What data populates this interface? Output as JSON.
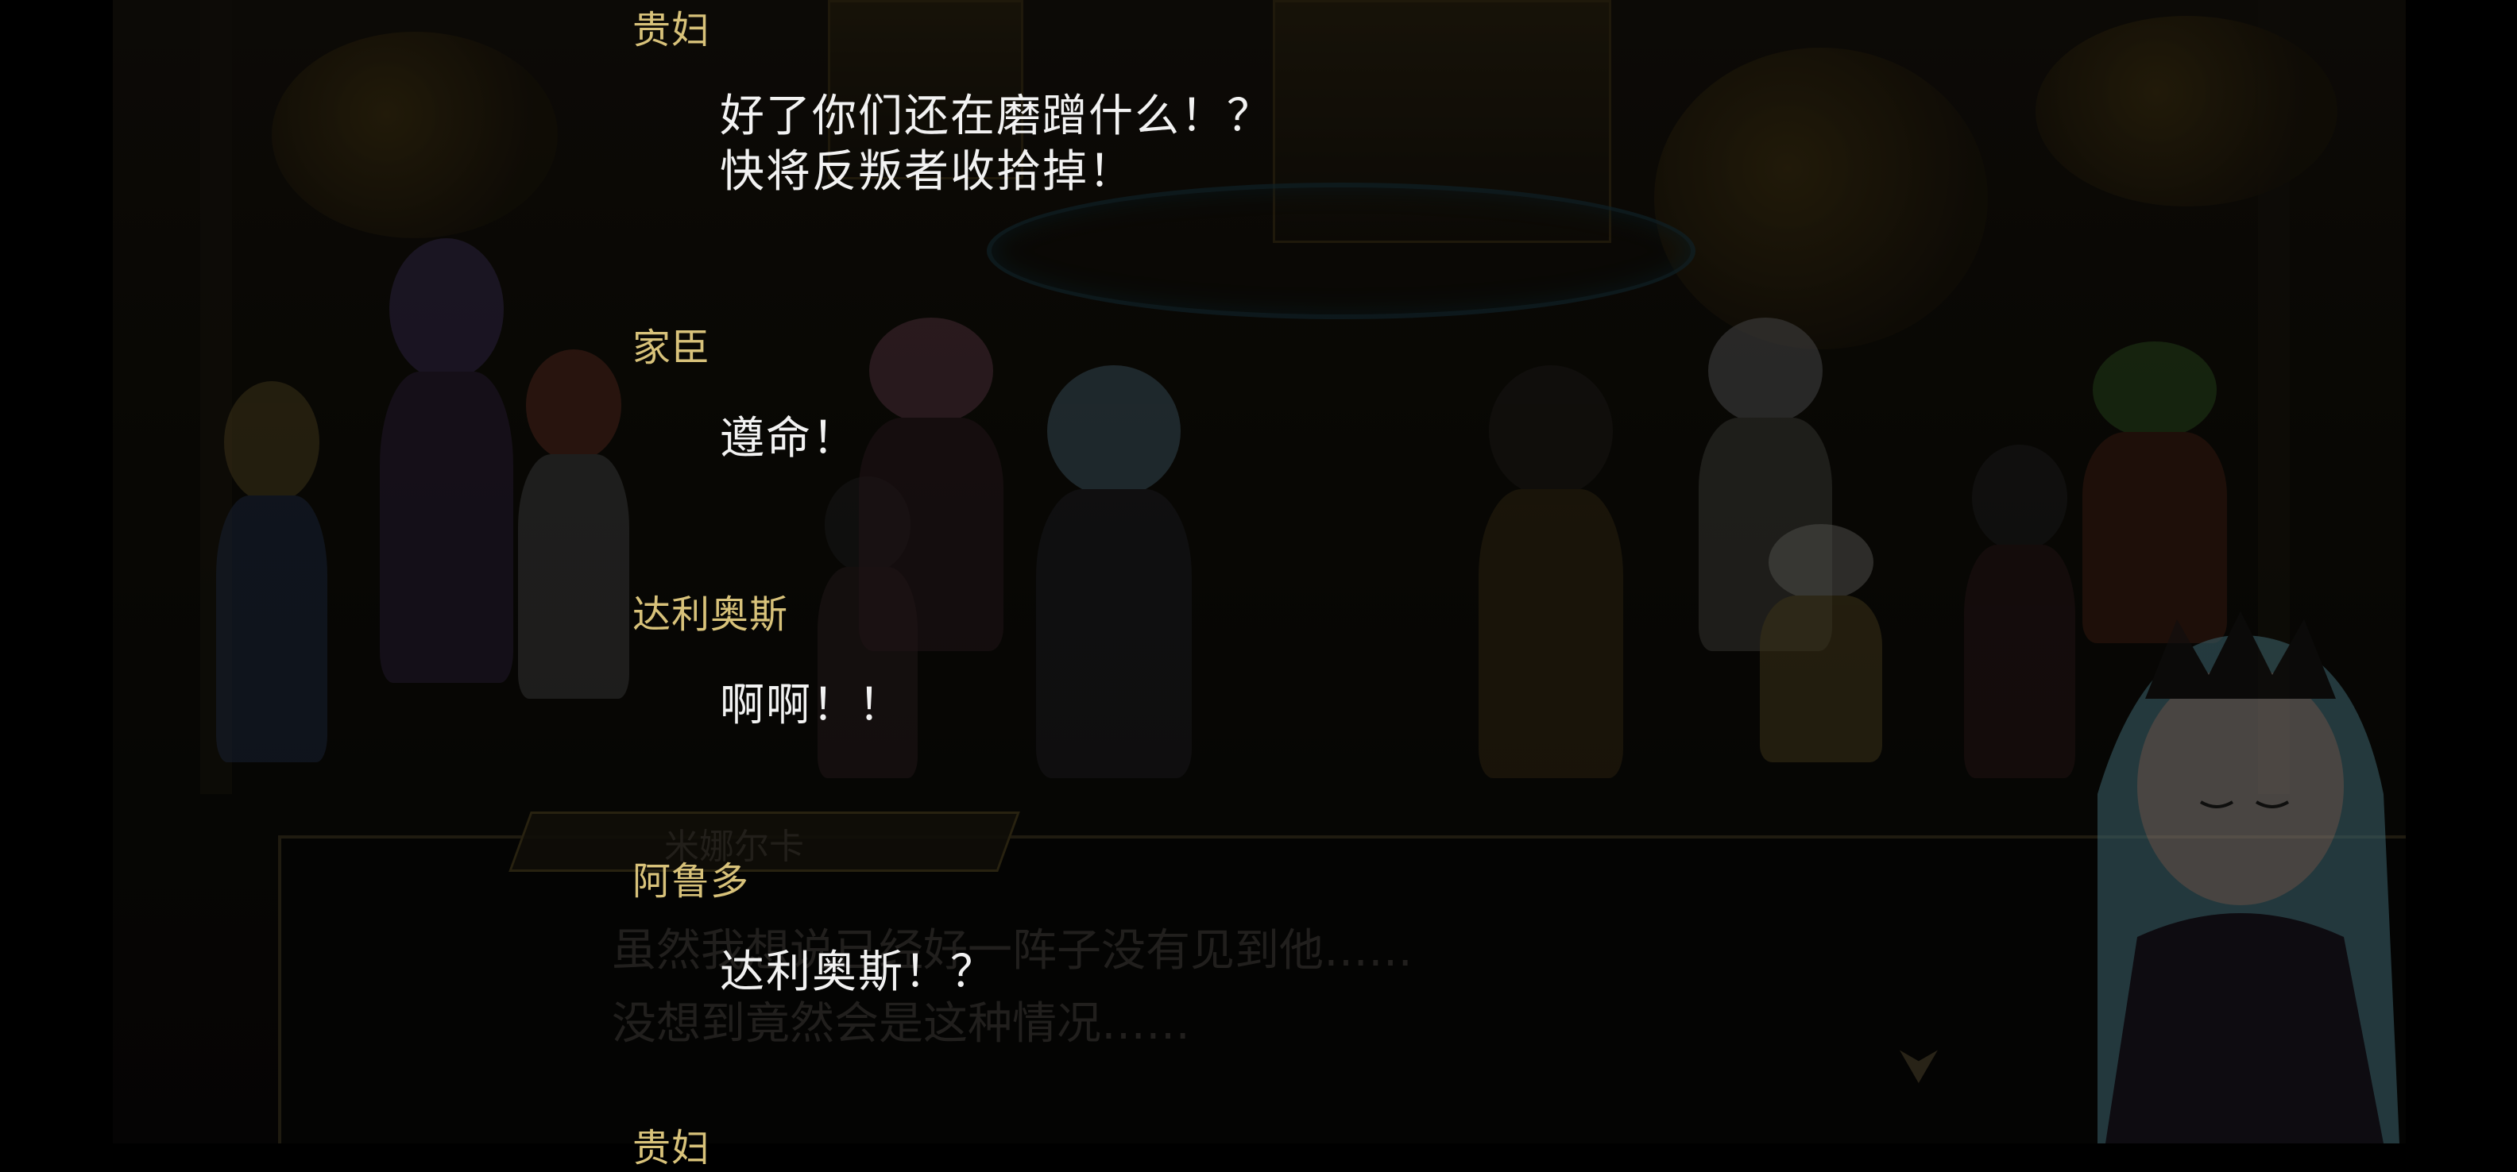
{
  "background_dialog": {
    "speaker": "米娜尔卡",
    "lines": [
      "虽然我想说已经好一阵子没有见到他……",
      "没想到竟然会是这种情况……"
    ]
  },
  "log": [
    {
      "speaker": "贵妇",
      "lines": [
        "好了你们还在磨蹭什么！？",
        "快将反叛者收拾掉！"
      ]
    },
    {
      "speaker": "家臣",
      "lines": [
        "遵命！"
      ]
    },
    {
      "speaker": "达利奥斯",
      "lines": [
        "啊啊！！"
      ]
    },
    {
      "speaker": "阿鲁多",
      "lines": [
        "达利奥斯！？"
      ]
    },
    {
      "speaker": "贵妇",
      "lines": []
    }
  ],
  "colors": {
    "speaker": "#d8c27a",
    "text": "#f2f2f2"
  }
}
